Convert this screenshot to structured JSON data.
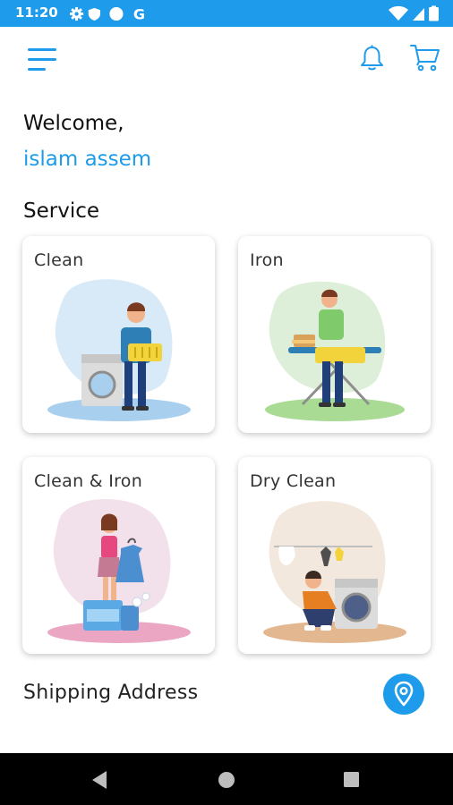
{
  "status_bar": {
    "time": "11:20",
    "left_icons": [
      "gear-icon",
      "shield-icon",
      "circle-icon",
      "google-g-icon"
    ],
    "right_icons": [
      "wifi-icon",
      "signal-icon",
      "battery-icon"
    ],
    "google_letter": "G"
  },
  "app_bar": {
    "menu_icon": "hamburger-menu-icon",
    "notification_icon": "bell-icon",
    "cart_icon": "cart-icon"
  },
  "greeting": {
    "welcome": "Welcome,",
    "username": "islam assem"
  },
  "services": {
    "title": "Service",
    "items": [
      {
        "label": "Clean",
        "illustration": "man-with-laundry-basket-and-washer"
      },
      {
        "label": "Iron",
        "illustration": "man-ironing-clothes"
      },
      {
        "label": "Clean & Iron",
        "illustration": "woman-holding-shirt-with-detergent"
      },
      {
        "label": "Dry Clean",
        "illustration": "man-loading-washing-machine"
      }
    ]
  },
  "shipping": {
    "label": "Shipping Address",
    "icon": "location-pin-icon"
  },
  "nav_bar": {
    "icons": [
      "back-icon",
      "home-icon",
      "recents-icon"
    ]
  },
  "colors": {
    "accent": "#1E9BEA",
    "status_bar": "#1E9BEA",
    "nav_bar": "#000000",
    "text": "#111111"
  }
}
